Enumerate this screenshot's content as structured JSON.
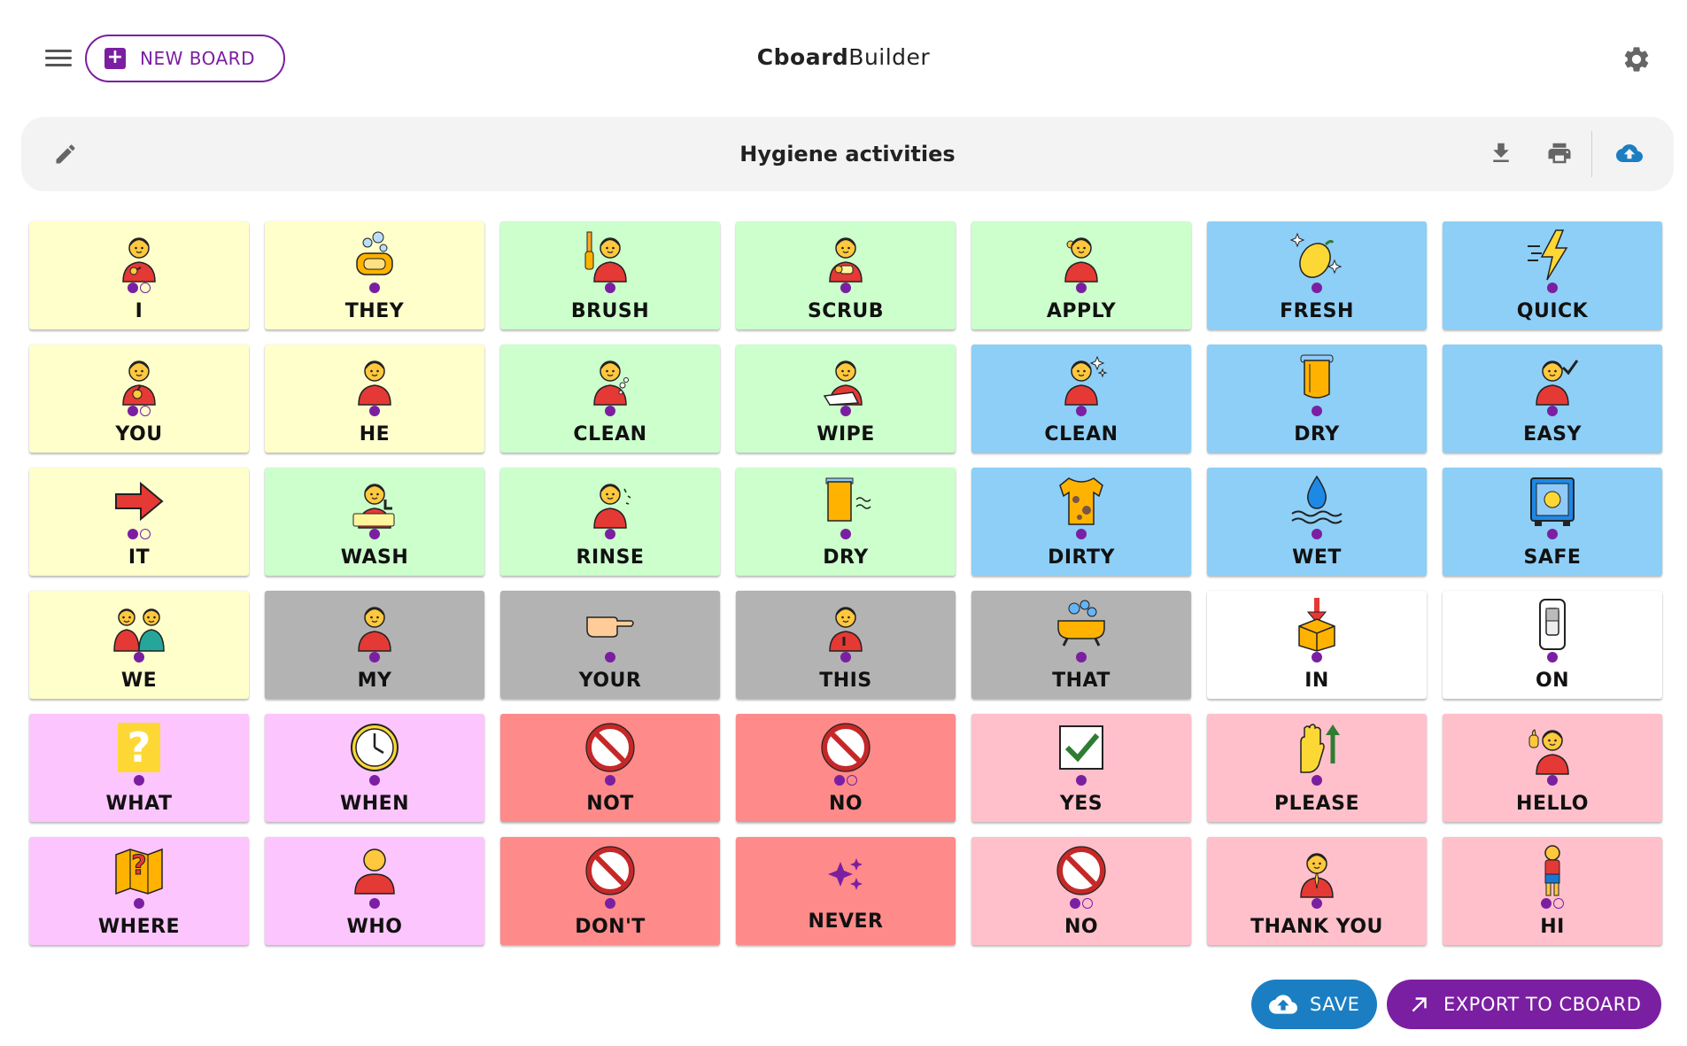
{
  "app": {
    "title_bold": "Cboard",
    "title_rest": "Builder",
    "new_board_label": "NEW BOARD",
    "menu_icon": "menu-icon",
    "settings_icon": "gear-icon"
  },
  "board": {
    "title": "Hygiene activities",
    "actions": [
      "edit",
      "download",
      "print",
      "upload"
    ]
  },
  "colors": {
    "accent": "#7b1fa2",
    "save_blue": "#1b7ec2",
    "yellow": "#ffffcc",
    "green": "#ccffcc",
    "blue": "#8ecff7",
    "gray": "#b3b3b3",
    "white": "#ffffff",
    "magenta": "#fdc5fd",
    "red": "#fe8a8a",
    "pink": "#ffc0cb"
  },
  "tiles": [
    [
      {
        "label": "I",
        "color": "yellow",
        "dots": "fo",
        "icon": "person-pointing-self"
      },
      {
        "label": "THEY",
        "color": "yellow",
        "dots": "f",
        "icon": "soap"
      },
      {
        "label": "BRUSH",
        "color": "green",
        "dots": "f",
        "icon": "person-brushing-hair"
      },
      {
        "label": "SCRUB",
        "color": "green",
        "dots": "f",
        "icon": "person-scrubbing"
      },
      {
        "label": "APPLY",
        "color": "green",
        "dots": "f",
        "icon": "person-applying"
      },
      {
        "label": "FRESH",
        "color": "blue",
        "dots": "f",
        "icon": "lemon-sparkles"
      },
      {
        "label": "QUICK",
        "color": "blue",
        "dots": "f",
        "icon": "lightning"
      }
    ],
    [
      {
        "label": "YOU",
        "color": "yellow",
        "dots": "fo",
        "icon": "person-pointing"
      },
      {
        "label": "HE",
        "color": "yellow",
        "dots": "f",
        "icon": "person"
      },
      {
        "label": "CLEAN",
        "color": "green",
        "dots": "f",
        "icon": "person-cleaning"
      },
      {
        "label": "WIPE",
        "color": "green",
        "dots": "f",
        "icon": "person-wiping"
      },
      {
        "label": "CLEAN",
        "color": "blue",
        "dots": "f",
        "icon": "person-sparkles"
      },
      {
        "label": "DRY",
        "color": "blue",
        "dots": "f",
        "icon": "towel"
      },
      {
        "label": "EASY",
        "color": "blue",
        "dots": "f",
        "icon": "person-check"
      }
    ],
    [
      {
        "label": "IT",
        "color": "yellow",
        "dots": "fo",
        "icon": "red-arrow"
      },
      {
        "label": "WASH",
        "color": "green",
        "dots": "f",
        "icon": "person-washing"
      },
      {
        "label": "RINSE",
        "color": "green",
        "dots": "f",
        "icon": "person-rinsing"
      },
      {
        "label": "DRY",
        "color": "green",
        "dots": "f",
        "icon": "towel-wind"
      },
      {
        "label": "DIRTY",
        "color": "blue",
        "dots": "f",
        "icon": "dirty-shirt"
      },
      {
        "label": "WET",
        "color": "blue",
        "dots": "f",
        "icon": "water-drop"
      },
      {
        "label": "SAFE",
        "color": "blue",
        "dots": "f",
        "icon": "safe-box"
      }
    ],
    [
      {
        "label": "WE",
        "color": "yellow",
        "dots": "f",
        "icon": "two-people"
      },
      {
        "label": "MY",
        "color": "gray",
        "dots": "f",
        "icon": "person"
      },
      {
        "label": "YOUR",
        "color": "gray",
        "dots": "f",
        "icon": "pointing-hand"
      },
      {
        "label": "THIS",
        "color": "gray",
        "dots": "f",
        "icon": "person-pointing-down"
      },
      {
        "label": "THAT",
        "color": "gray",
        "dots": "f",
        "icon": "bathtub"
      },
      {
        "label": "IN",
        "color": "white",
        "dots": "f",
        "icon": "box-arrow-in"
      },
      {
        "label": "ON",
        "color": "white",
        "dots": "f",
        "icon": "switch-on"
      }
    ],
    [
      {
        "label": "WHAT",
        "color": "magenta",
        "dots": "f",
        "icon": "question-mark"
      },
      {
        "label": "WHEN",
        "color": "magenta",
        "dots": "f",
        "icon": "clock"
      },
      {
        "label": "NOT",
        "color": "red",
        "dots": "f",
        "icon": "prohibited"
      },
      {
        "label": "NO",
        "color": "red",
        "dots": "fo",
        "icon": "prohibited"
      },
      {
        "label": "YES",
        "color": "pink",
        "dots": "f",
        "icon": "checkmark"
      },
      {
        "label": "PLEASE",
        "color": "pink",
        "dots": "f",
        "icon": "hand-arrow-up"
      },
      {
        "label": "HELLO",
        "color": "pink",
        "dots": "f",
        "icon": "person-waving"
      }
    ],
    [
      {
        "label": "WHERE",
        "color": "magenta",
        "dots": "f",
        "icon": "map-question"
      },
      {
        "label": "WHO",
        "color": "magenta",
        "dots": "f",
        "icon": "person-silhouette"
      },
      {
        "label": "DON'T",
        "color": "red",
        "dots": "f",
        "icon": "prohibited"
      },
      {
        "label": "NEVER",
        "color": "red",
        "dots": "",
        "icon": "sparkles"
      },
      {
        "label": "NO",
        "color": "pink",
        "dots": "fo",
        "icon": "prohibited"
      },
      {
        "label": "THANK YOU",
        "color": "pink",
        "dots": "f",
        "icon": "person-praying"
      },
      {
        "label": "HI",
        "color": "pink",
        "dots": "fo",
        "icon": "person-standing"
      }
    ]
  ],
  "footer": {
    "save_label": "SAVE",
    "export_label": "EXPORT TO CBOARD"
  }
}
